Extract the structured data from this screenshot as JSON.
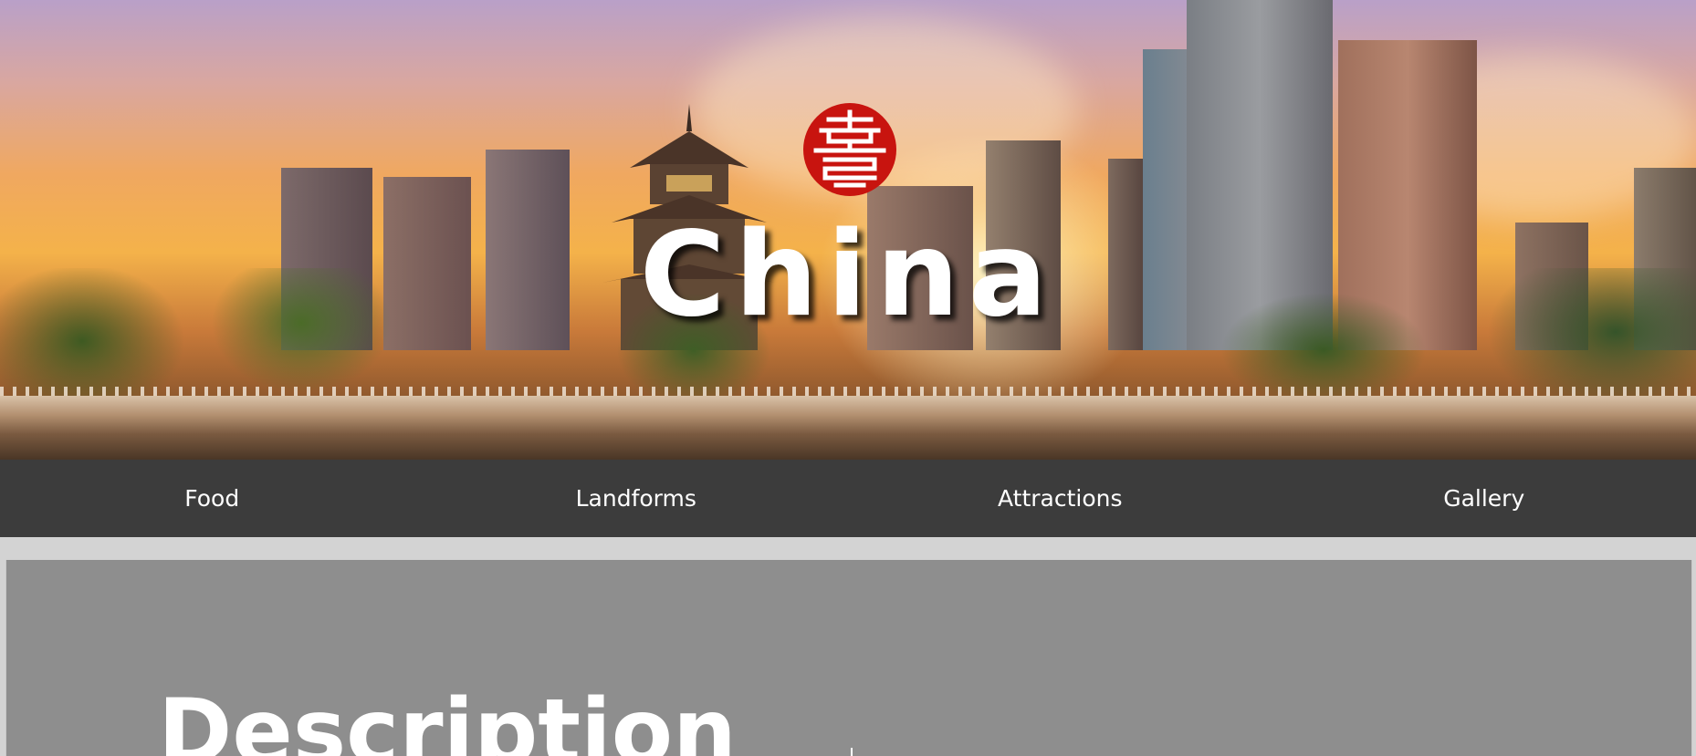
{
  "hero": {
    "title": "China",
    "emblem_icon": "shou-longevity-symbol-icon",
    "emblem_color": "#c8140f"
  },
  "nav": {
    "items": [
      {
        "label": "Food"
      },
      {
        "label": "Landforms"
      },
      {
        "label": "Attractions"
      },
      {
        "label": "Gallery"
      }
    ]
  },
  "main": {
    "section_title": "Description"
  },
  "colors": {
    "nav_background": "#3c3c3c",
    "content_background": "#8e8e8e",
    "page_background": "#d3d3d3"
  }
}
